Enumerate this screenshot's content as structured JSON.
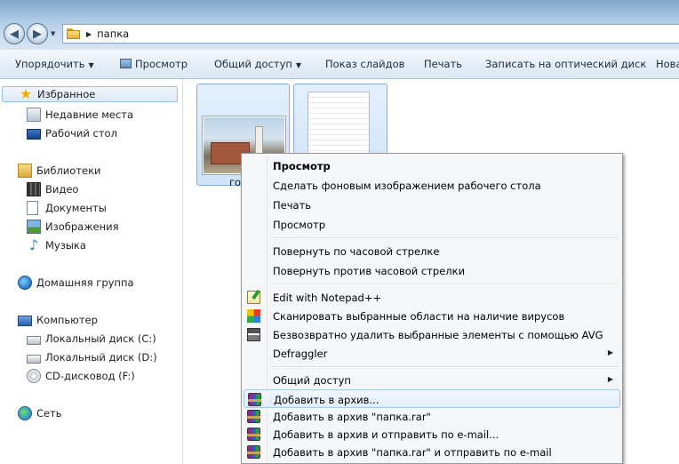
{
  "address": {
    "path": "папка"
  },
  "toolbar": {
    "organize": "Упорядочить",
    "view": "Просмотр",
    "share": "Общий доступ",
    "slideshow": "Показ слайдов",
    "print": "Печать",
    "burn": "Записать на оптический диск",
    "new_folder": "Нова"
  },
  "sidebar": {
    "favorites": "Избранное",
    "recent": "Недавние места",
    "desktop": "Рабочий стол",
    "libraries": "Библиотеки",
    "video": "Видео",
    "documents": "Документы",
    "images": "Изображения",
    "music": "Музыка",
    "homegroup": "Домашняя группа",
    "computer": "Компьютер",
    "drive_c": "Локальный диск (C:)",
    "drive_d": "Локальный диск (D:)",
    "cd_drive": "CD-дисковод (F:)",
    "network": "Сеть"
  },
  "files": [
    {
      "label": "гор"
    }
  ],
  "context_menu": {
    "preview_bold": "Просмотр",
    "set_wallpaper": "Сделать фоновым изображением рабочего стола",
    "print": "Печать",
    "preview": "Просмотр",
    "rotate_cw": "Повернуть по часовой стрелке",
    "rotate_ccw": "Повернуть против часовой стрелки",
    "notepad": "Edit with Notepad++",
    "avg_scan": "Сканировать выбранные области на наличие вирусов",
    "avg_shred": "Безвозвратно удалить выбранные элементы с помощью AVG",
    "defraggler": "Defraggler",
    "share": "Общий доступ",
    "add_archive": "Добавить в архив...",
    "add_rar": "Добавить в архив \"папка.rar\"",
    "add_email": "Добавить в архив и отправить по e-mail...",
    "add_rar_email": "Добавить в архив \"папка.rar\" и отправить по e-mail"
  },
  "icons": {
    "favorites": "star-icon",
    "archive": "winrar-icon",
    "notepad": "notepad-plus-icon",
    "avg": "avg-icon",
    "shredder": "shredder-icon"
  },
  "colors": {
    "selection": "#cde3f8",
    "menu_bg": "#f5f6f7",
    "highlight_border": "#a8c8ea"
  }
}
